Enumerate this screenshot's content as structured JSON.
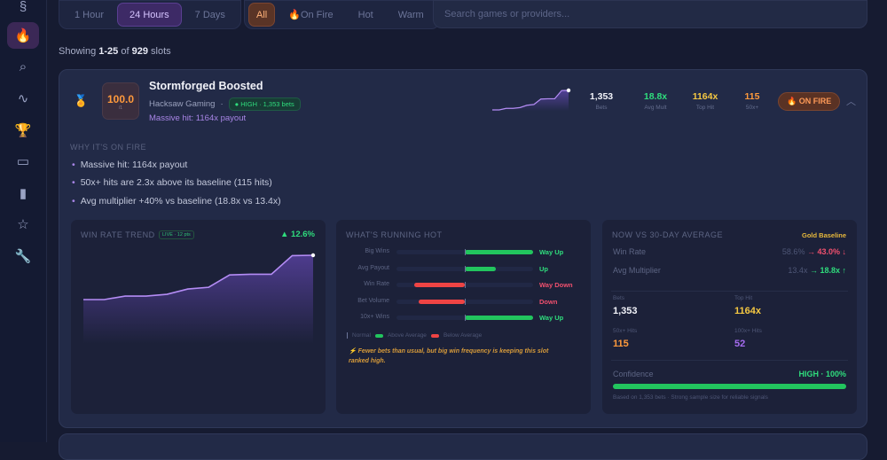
{
  "sidebar": {
    "items": [
      {
        "icon": "logo-icon",
        "glyph": "§"
      },
      {
        "icon": "fire-icon",
        "glyph": "🔥",
        "active": true
      },
      {
        "icon": "search-icon",
        "glyph": "⌕"
      },
      {
        "icon": "activity-icon",
        "glyph": "∿"
      },
      {
        "icon": "trophy-icon",
        "glyph": "🏆"
      },
      {
        "icon": "video-icon",
        "glyph": "▭"
      },
      {
        "icon": "bar-chart-icon",
        "glyph": "▮"
      },
      {
        "icon": "star-icon",
        "glyph": "☆"
      },
      {
        "icon": "wrench-icon",
        "glyph": "🔧"
      }
    ]
  },
  "time_filter": {
    "options": [
      "1 Hour",
      "24 Hours",
      "7 Days"
    ],
    "selected": "24 Hours"
  },
  "heat_filter": {
    "options": [
      "All",
      "On Fire",
      "Hot",
      "Warm"
    ],
    "selected": "All"
  },
  "search": {
    "placeholder": "Search games or providers..."
  },
  "showing": {
    "prefix": "Showing",
    "range": "1-25",
    "of": "of",
    "total": "929",
    "suffix": "slots"
  },
  "slot": {
    "score": "100.0",
    "score_sub": "/1",
    "title": "Stormforged Boosted",
    "provider": "Hacksaw Gaming",
    "separator": "·",
    "confidence_badge": "HIGH · 1,353 bets",
    "highlight": "Massive hit: 1164x payout",
    "sparkline": [
      30,
      30,
      31,
      31,
      31.5,
      33,
      33.5,
      37,
      37.2,
      37.2,
      42.5,
      42.6
    ],
    "stats": [
      {
        "value": "1,353",
        "label": "Bets",
        "color": "#f1f2f8"
      },
      {
        "value": "18.8x",
        "label": "Avg Mult",
        "color": "#2fdd7d"
      },
      {
        "value": "1164x",
        "label": "Top Hit",
        "color": "#f5c842"
      },
      {
        "value": "115",
        "label": "50x+",
        "color": "#ff9a3c"
      }
    ],
    "status_badge": "ON FIRE",
    "why_title": "WHY IT'S ON FIRE",
    "reasons": [
      "Massive hit: 1164x payout",
      "50x+ hits are 2.3x above its baseline (115 hits)",
      "Avg multiplier +40% vs baseline (18.8x vs 13.4x)"
    ],
    "trend": {
      "title": "WIN RATE TREND",
      "live": "LIVE · 12 pts",
      "change": "▲ 12.6%"
    },
    "running_hot": {
      "title": "WHAT'S RUNNING HOT",
      "rows": [
        {
          "label": "Big Wins",
          "value": 1.0,
          "status": "Way Up"
        },
        {
          "label": "Avg Payout",
          "value": 0.45,
          "status": "Up"
        },
        {
          "label": "Win Rate",
          "value": -0.74,
          "status": "Way Down"
        },
        {
          "label": "Bet Volume",
          "value": -0.67,
          "status": "Down"
        },
        {
          "label": "10x+ Wins",
          "value": 1.0,
          "status": "Way Up"
        }
      ],
      "legend": [
        "Normal",
        "Above Average",
        "Below Average"
      ],
      "note": "⚡ Fewer bets than usual, but big win frequency is keeping this slot ranked high."
    },
    "comparison": {
      "title": "NOW VS 30-DAY AVERAGE",
      "baseline": "Gold Baseline",
      "rows": [
        {
          "label": "Win Rate",
          "old": "58.6%",
          "new": "→ 43.0% ↓",
          "color": "#f0506e"
        },
        {
          "label": "Avg Multiplier",
          "old": "13.4x",
          "new": "→ 18.8x ↑",
          "color": "#2fdd7d"
        }
      ],
      "metrics": [
        {
          "label": "Bets",
          "value": "1,353",
          "color": "#f1f2f8"
        },
        {
          "label": "Top Hit",
          "value": "1164x",
          "color": "#f5c842"
        },
        {
          "label": "50x+ Hits",
          "value": "115",
          "color": "#ff9a3c"
        },
        {
          "label": "100x+ Hits",
          "value": "52",
          "color": "#a56cf0"
        }
      ],
      "confidence_label": "Confidence",
      "confidence_value": "HIGH · 100%",
      "confidence_pct": 100,
      "footnote": "Based on 1,353 bets · Strong sample size for reliable signals"
    }
  },
  "colors": {
    "up": "#22c55e",
    "down": "#ef4444",
    "accent": "#a885e6"
  }
}
